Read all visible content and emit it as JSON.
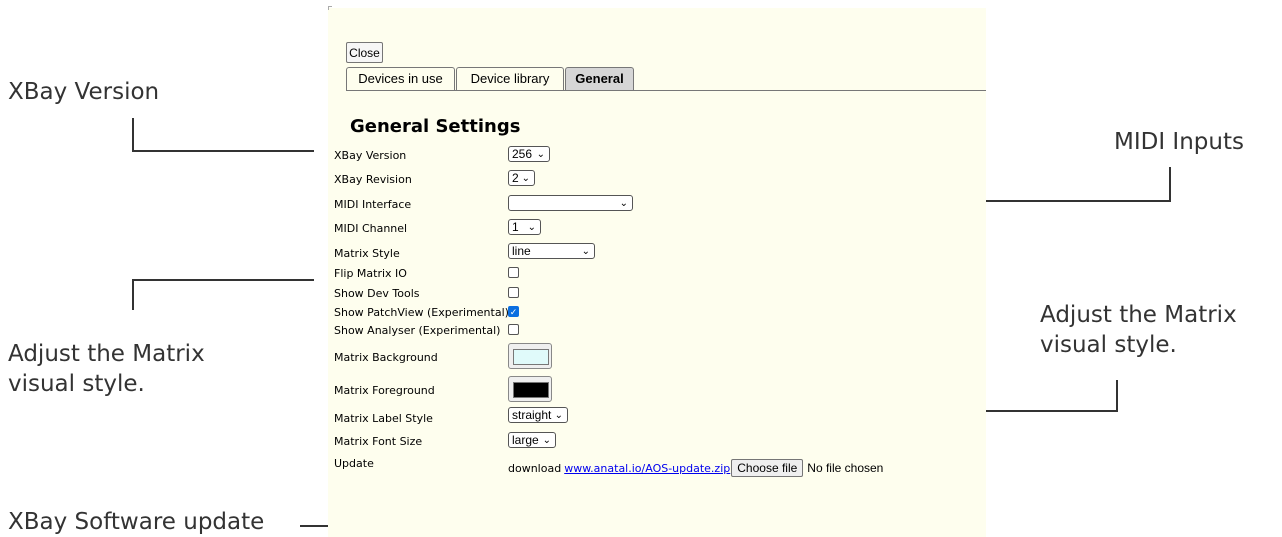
{
  "callouts": {
    "xbay_version": "XBay Version",
    "midi_inputs": "MIDI Inputs",
    "matrix_style_left": "Adjust the Matrix\nvisual style.",
    "matrix_style_right": "Adjust the Matrix\nvisual style.",
    "software_update": "XBay Software update"
  },
  "dialog": {
    "close_label": "Close",
    "tabs": [
      {
        "label": "Devices in use",
        "active": false
      },
      {
        "label": "Device library",
        "active": false
      },
      {
        "label": "General",
        "active": true
      }
    ],
    "heading": "General Settings"
  },
  "settings": {
    "xbay_version": {
      "label": "XBay Version",
      "value": "256"
    },
    "xbay_revision": {
      "label": "XBay Revision",
      "value": "2"
    },
    "midi_interface": {
      "label": "MIDI Interface",
      "value": ""
    },
    "midi_channel": {
      "label": "MIDI Channel",
      "value": "1"
    },
    "matrix_style": {
      "label": "Matrix Style",
      "value": "line"
    },
    "flip_matrix_io": {
      "label": "Flip Matrix IO",
      "checked": false
    },
    "show_dev_tools": {
      "label": "Show Dev Tools",
      "checked": false
    },
    "show_patchview": {
      "label": "Show PatchView (Experimental)",
      "checked": true
    },
    "show_analyser": {
      "label": "Show Analyser (Experimental)",
      "checked": false
    },
    "matrix_background": {
      "label": "Matrix Background",
      "color": "#e0fafa"
    },
    "matrix_foreground": {
      "label": "Matrix Foreground",
      "color": "#000000"
    },
    "matrix_label_style": {
      "label": "Matrix Label Style",
      "value": "straight"
    },
    "matrix_font_size": {
      "label": "Matrix Font Size",
      "value": "large"
    },
    "update": {
      "label": "Update",
      "download_text": "download",
      "link_text": "www.anatal.io/AOS-update.zip",
      "file_button": "Choose file",
      "file_status": "No file chosen"
    }
  }
}
